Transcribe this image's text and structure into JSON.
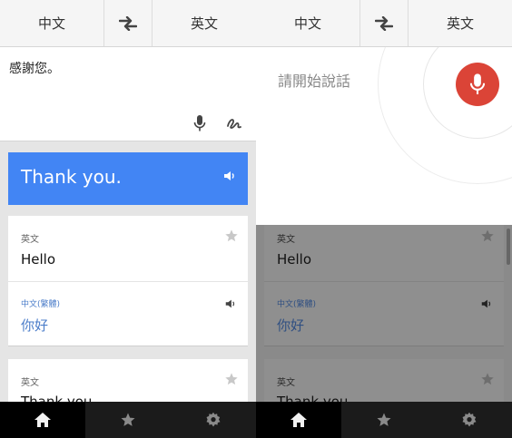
{
  "lang_bar": {
    "source": "中文",
    "target": "英文"
  },
  "left": {
    "input_text": "感謝您。",
    "result_text": "Thank you.",
    "cards": [
      {
        "lang": "英文",
        "word": "Hello",
        "lang2": "中文(繁體)",
        "word2": "你好"
      },
      {
        "lang": "英文",
        "word": "Thank you"
      }
    ]
  },
  "right": {
    "prompt": "請開始說話",
    "cards": [
      {
        "lang": "英文",
        "word": "Hello",
        "lang2": "中文(繁體)",
        "word2": "你好"
      },
      {
        "lang": "英文",
        "word": "Thank you"
      }
    ]
  },
  "tabs": [
    {
      "icon": "home-icon",
      "active": true
    },
    {
      "icon": "star-icon",
      "active": false
    },
    {
      "icon": "gear-icon",
      "active": false
    }
  ],
  "colors": {
    "accent": "#4285f4",
    "mic": "#db4437",
    "tabbar": "#1b1b1b",
    "link": "#4a7cc9"
  }
}
